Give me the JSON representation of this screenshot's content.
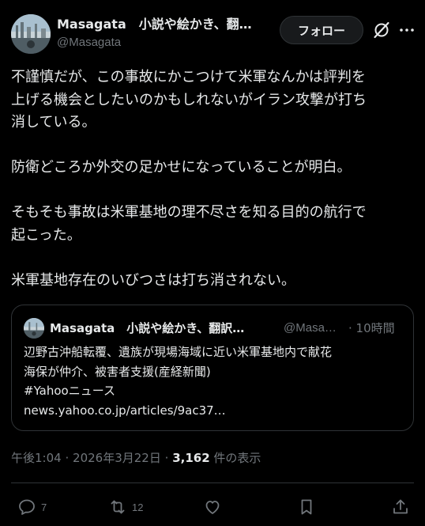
{
  "author": {
    "display_name": "Masagata　小説や絵かき、翻…",
    "handle": "@Masagata",
    "avatar_icon": "profile-photo-icon"
  },
  "header_actions": {
    "follow_label": "フォロー",
    "grok_icon": "grok-icon",
    "more_icon": "more-icon"
  },
  "tweet": {
    "paragraphs": [
      [
        "不謹慎だが、この事故にかこつけて米軍なんかは評判を",
        "上げる機会としたいのかもしれないがイラン攻撃が打ち",
        "消している。"
      ],
      [
        "防衛どころか外交の足かせになっていることが明白。"
      ],
      [
        "そもそも事故は米軍基地の理不尽さを知る目的の航行で",
        "起こった。"
      ],
      [
        "米軍基地存在のいびつさは打ち消されない。"
      ]
    ]
  },
  "quote": {
    "display_name": "Masagata　小説や絵かき、翻訳…",
    "handle": "@Masa…",
    "time": "· 10時間",
    "lines": [
      "辺野古沖船転覆、遺族が現場海域に近い米軍基地内で献花",
      "海保が仲介、被害者支援(産経新聞)",
      "#Yahooニュース",
      "news.yahoo.co.jp/articles/9ac37…"
    ]
  },
  "meta": {
    "time": "午後1:04",
    "separator": "·",
    "date": "2026年3月22日",
    "views_count": "3,162",
    "views_label": "件の表示"
  },
  "actions": {
    "reply_count": "7",
    "repost_count": "12",
    "like_count": "",
    "bookmark_count": "",
    "share_count": ""
  },
  "colors": {
    "background": "#000000",
    "text_primary": "#e7e9ea",
    "text_secondary": "#71767b",
    "border": "#2f3336"
  }
}
